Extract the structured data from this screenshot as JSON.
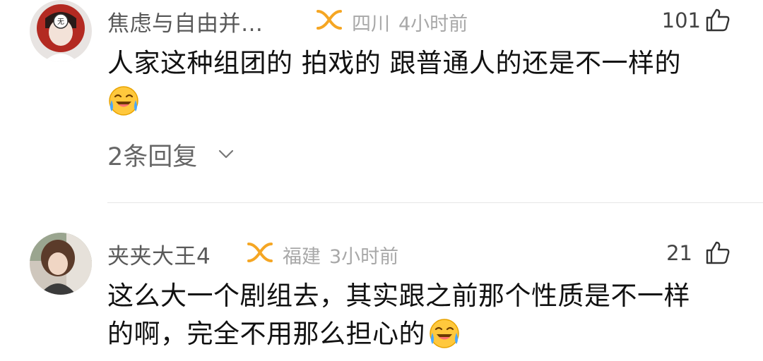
{
  "colors": {
    "badge_orange": "#f5a623",
    "emoji_yellow": "#ffc83d",
    "muted": "#a8a8a8"
  },
  "comments": [
    {
      "username": "焦虑与自由并…",
      "badge_icon": "vip-badge-icon",
      "location": "四川",
      "time": "4小时前",
      "likes": "101",
      "text_line1": "人家这种组团的 拍戏的 跟普通人的还是不一样的",
      "emoji": "laugh-cry-emoji",
      "replies_label": "2条回复"
    },
    {
      "username": "夹夹大王4",
      "badge_icon": "vip-badge-icon",
      "location": "福建",
      "time": "3小时前",
      "likes": "21",
      "text_line1": "这么大一个剧组去，其实跟之前那个性质是不一样",
      "text_line2": "的啊，完全不用那么担心的",
      "emoji": "laugh-cry-emoji"
    }
  ]
}
